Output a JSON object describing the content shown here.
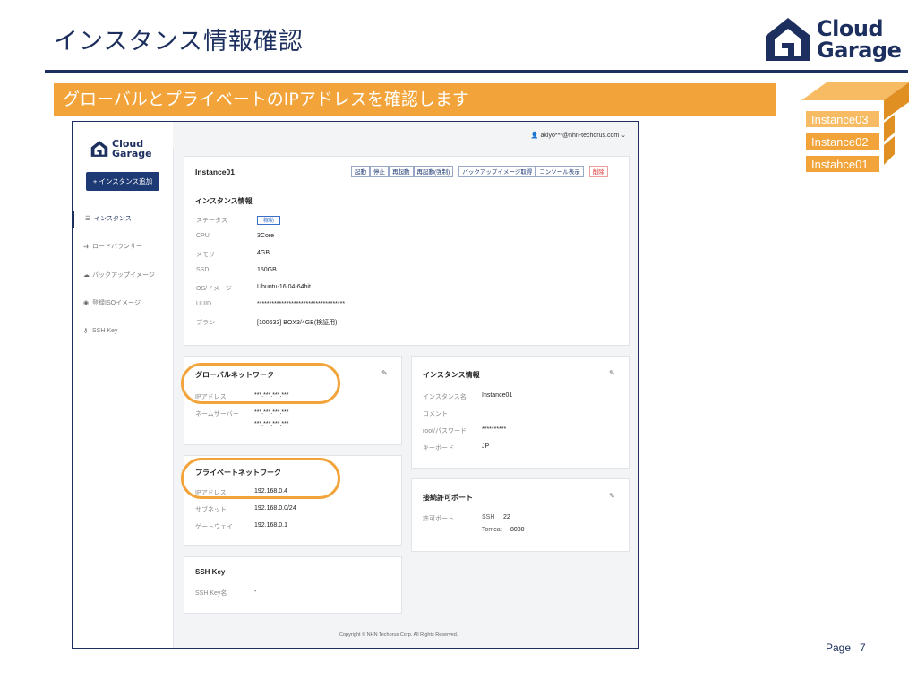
{
  "slide": {
    "title": "インスタンス情報確認",
    "banner": "グローバルとプライベートのIPアドレスを確認します",
    "page_label": "Page",
    "page_number": "7"
  },
  "brand": {
    "logo_line1": "Cloud",
    "logo_line2": "Garage",
    "color": "#1d2f5e",
    "accent": "#f2a43a"
  },
  "instance_stack": [
    "Instance03",
    "Instance02",
    "Instahce01"
  ],
  "app": {
    "user": "akiyo***@nhn-techorus.com",
    "logo_line1": "Cloud",
    "logo_line2": "Garage",
    "add_instance": "+ インスタンス追加",
    "nav": [
      "インスタンス",
      "ロードバランサー",
      "バックアップイメージ",
      "登録ISOイメージ",
      "SSH Key"
    ],
    "instance_name": "Instance01",
    "actions": [
      "起動",
      "停止",
      "再起動",
      "再起動(強制)",
      "バックアップイメージ取得",
      "コンソール表示",
      "削除"
    ],
    "info": {
      "title": "インスタンス情報",
      "rows": [
        {
          "label": "ステータス",
          "value": "稼動"
        },
        {
          "label": "CPU",
          "value": "3Core"
        },
        {
          "label": "メモリ",
          "value": "4GB"
        },
        {
          "label": "SSD",
          "value": "150GB"
        },
        {
          "label": "OS/イメージ",
          "value": "Ubuntu-16.04-64bit"
        },
        {
          "label": "UUID",
          "value": "************************************"
        },
        {
          "label": "プラン",
          "value": "[100633] BOX3/4GB(検証用)"
        }
      ]
    },
    "global": {
      "title": "グローバルネットワーク",
      "ip_label": "IPアドレス",
      "ip": "***.***.***.***",
      "ns_label": "ネームサーバー",
      "ns1": "***.***.***.***",
      "ns2": "***.***.***.***"
    },
    "private": {
      "title": "プライベートネットワーク",
      "ip_label": "IPアドレス",
      "ip": "192.168.0.4",
      "subnet_label": "サブネット",
      "subnet": "192.168.0.0/24",
      "gw_label": "ゲートウェイ",
      "gw": "192.168.0.1"
    },
    "sshkey": {
      "title": "SSH Key",
      "label": "SSH Key名",
      "value": "-"
    },
    "details": {
      "title": "インスタンス情報",
      "name_label": "インスタンス名",
      "name": "Instance01",
      "comment_label": "コメント",
      "pw_label": "root/パスワード",
      "pw": "**********",
      "kb_label": "キーボード",
      "kb": "JP"
    },
    "ports": {
      "title": "接続許可ポート",
      "label": "許可ポート",
      "rows": [
        {
          "name": "SSH",
          "port": "22"
        },
        {
          "name": "Tomcat",
          "port": "8080"
        }
      ]
    },
    "footer": "Copyright © NHN Techorus Corp. All Rights Reserved."
  }
}
